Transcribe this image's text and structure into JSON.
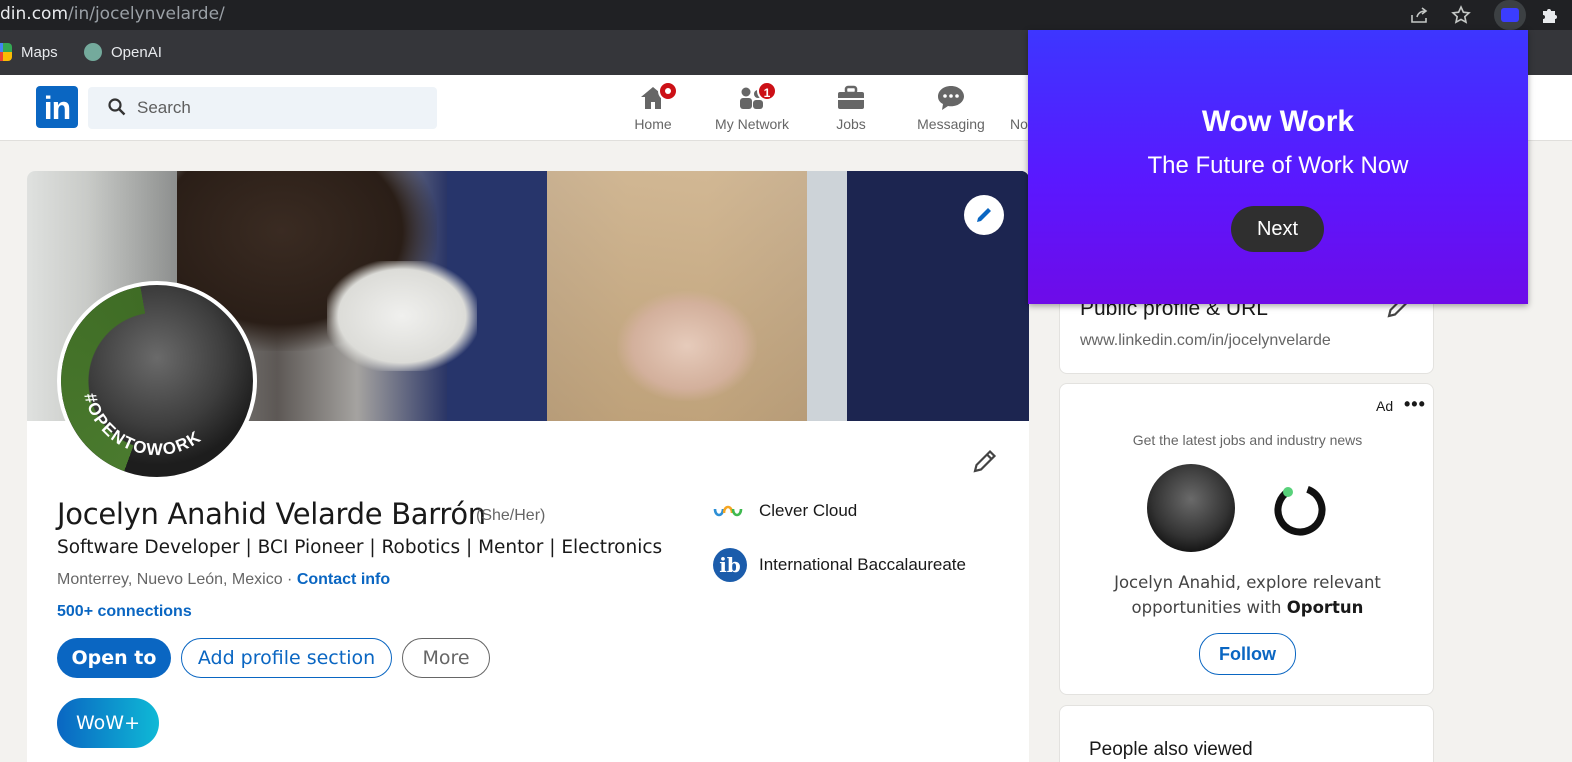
{
  "browser": {
    "url_host": "din.com",
    "url_path": "/in/jocelynvelarde/",
    "bookmarks": [
      {
        "label": "Maps"
      },
      {
        "label": "OpenAI"
      }
    ]
  },
  "nav": {
    "search_placeholder": "Search",
    "items": [
      {
        "label": "Home",
        "icon": "home-icon",
        "badge": ""
      },
      {
        "label": "My Network",
        "icon": "network-icon",
        "badge": "1"
      },
      {
        "label": "Jobs",
        "icon": "briefcase-icon",
        "badge": ""
      },
      {
        "label": "Messaging",
        "icon": "chat-icon",
        "badge": ""
      },
      {
        "label": "No",
        "icon": "bell-icon",
        "badge": ""
      }
    ]
  },
  "profile": {
    "name": "Jocelyn Anahid Velarde Barrón",
    "pronouns": "(She/Her)",
    "headline": "Software Developer | BCI Pioneer | Robotics | Mentor | Electronics",
    "location": "Monterrey, Nuevo León, Mexico",
    "location_separator": " · ",
    "contact_info": "Contact info",
    "connections": "500+ connections",
    "avatar_frame_text": "#OPENTOWORK",
    "buttons": {
      "open_to": "Open to",
      "add_section": "Add profile section",
      "more": "More",
      "wow": "WoW+"
    },
    "experience": [
      {
        "name": "Clever Cloud"
      },
      {
        "name": "International Baccalaureate",
        "logo_letter": "ib"
      }
    ]
  },
  "rail": {
    "public_profile": {
      "title": "Public profile & URL",
      "url": "www.linkedin.com/in/jocelynvelarde"
    },
    "ad": {
      "label": "Ad",
      "menu": "•••",
      "subtitle": "Get the latest jobs and industry news",
      "text_prefix": "Jocelyn Anahid, explore relevant opportunities with ",
      "company": "Oportun",
      "follow": "Follow"
    },
    "people_also_viewed": "People also viewed"
  },
  "popup": {
    "title": "Wow Work",
    "subtitle": "The Future of Work Now",
    "next": "Next"
  },
  "colors": {
    "linkedin_blue": "#0a66c2",
    "popup_gradient_top": "#3d36ff",
    "popup_gradient_bottom": "#6e0be8",
    "badge_red": "#cc1016",
    "open_to_work_green": "#4a7a2e"
  }
}
